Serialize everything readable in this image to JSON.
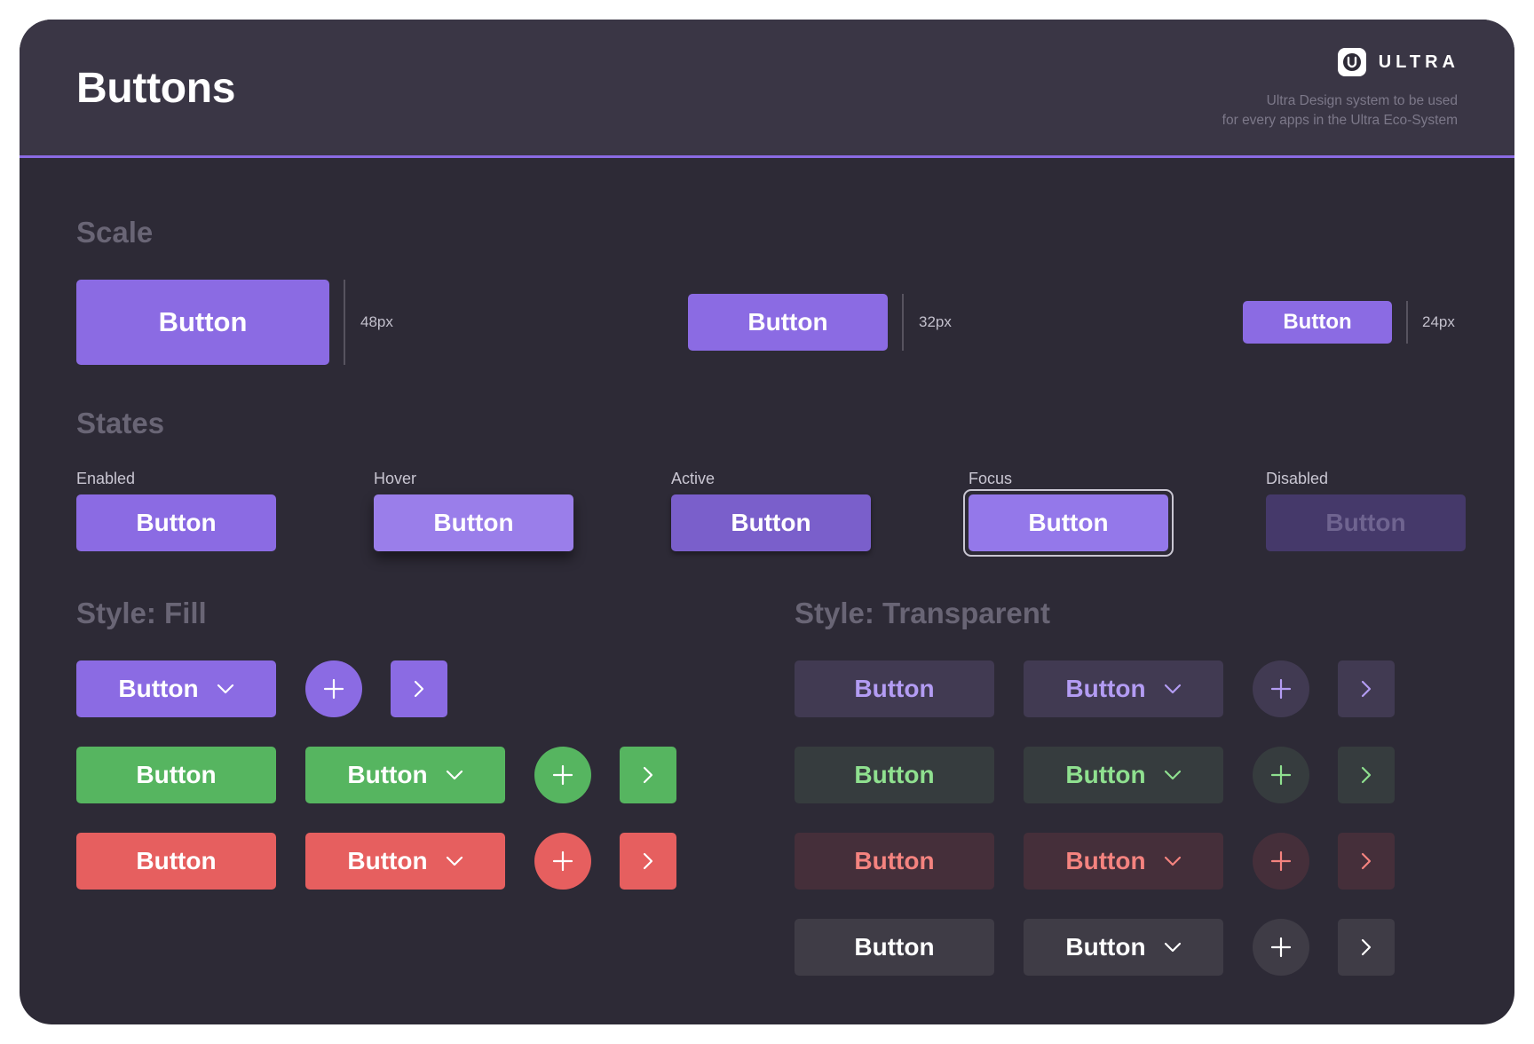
{
  "header": {
    "title": "Buttons",
    "brand_name": "ULTRA",
    "tagline_line1": "Ultra Design system to be used",
    "tagline_line2": "for every apps in the Ultra Eco-System"
  },
  "scale": {
    "title": "Scale",
    "items": [
      {
        "button_label": "Button",
        "size_label": "48px"
      },
      {
        "button_label": "Button",
        "size_label": "32px"
      },
      {
        "button_label": "Button",
        "size_label": "24px"
      }
    ]
  },
  "states": {
    "title": "States",
    "items": [
      {
        "state": "Enabled",
        "button_label": "Button"
      },
      {
        "state": "Hover",
        "button_label": "Button"
      },
      {
        "state": "Active",
        "button_label": "Button"
      },
      {
        "state": "Focus",
        "button_label": "Button"
      },
      {
        "state": "Disabled",
        "button_label": "Button"
      }
    ]
  },
  "style_fill": {
    "title": "Style: Fill",
    "rows": [
      {
        "color": "purple",
        "button_label": "Button",
        "dropdown_label": "Button"
      },
      {
        "color": "green",
        "button_label": "Button",
        "dropdown_label": "Button"
      },
      {
        "color": "red",
        "button_label": "Button",
        "dropdown_label": "Button"
      }
    ]
  },
  "style_transparent": {
    "title": "Style: Transparent",
    "rows": [
      {
        "color": "purple",
        "button_label": "Button",
        "dropdown_label": "Button"
      },
      {
        "color": "green",
        "button_label": "Button",
        "dropdown_label": "Button"
      },
      {
        "color": "red",
        "button_label": "Button",
        "dropdown_label": "Button"
      },
      {
        "color": "grey",
        "button_label": "Button",
        "dropdown_label": "Button"
      }
    ]
  },
  "icons": {
    "add": "plus-icon",
    "next": "chevron-right-icon",
    "dropdown": "chevron-down-icon",
    "brand": "ultra-logo-icon"
  },
  "colors": {
    "background": "#2d2a36",
    "header": "#3a3645",
    "accent_purple": "#8b6be3",
    "success_green": "#56b560",
    "danger_red": "#e65f5f"
  }
}
